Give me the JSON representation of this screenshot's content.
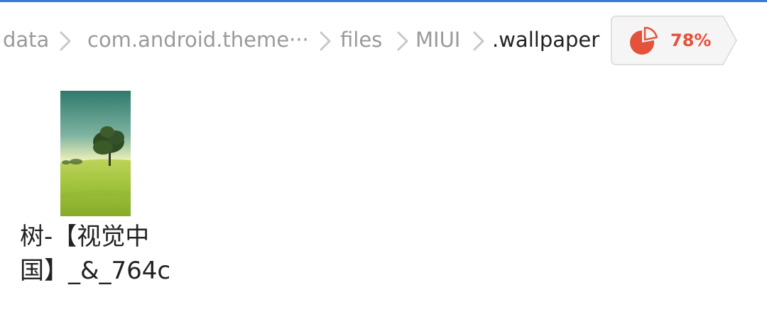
{
  "breadcrumb": {
    "items": [
      {
        "label": "data"
      },
      {
        "label": "com.android.theme···"
      },
      {
        "label": "files"
      },
      {
        "label": "MIUI"
      },
      {
        "label": ".wallpaper"
      }
    ]
  },
  "storage": {
    "percent_label": "78%",
    "used_fraction": 0.78,
    "icon": "pie-chart-icon",
    "accent_color": "#e4523b"
  },
  "files": [
    {
      "name": "树-【视觉中国】_&_764c",
      "thumbnail": "tree-on-meadow-image"
    }
  ],
  "colors": {
    "breadcrumb_inactive": "#9a9a9a",
    "breadcrumb_active": "#222222",
    "top_bar": "#3b78d8"
  }
}
